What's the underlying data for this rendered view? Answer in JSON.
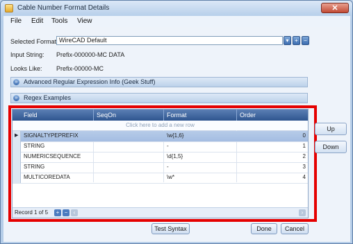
{
  "window": {
    "title": "Cable Number Format Details",
    "close_icon": "x-icon"
  },
  "menu": [
    "File",
    "Edit",
    "Tools",
    "View"
  ],
  "form": {
    "selected_format_label": "Selected Format:",
    "selected_format_value": "WireCAD Default",
    "input_string_label": "Input String:",
    "input_string_value": "Prefix-000000-MC DATA",
    "looks_like_label": "Looks Like:",
    "looks_like_value": "Prefix-00000-MC"
  },
  "panels": {
    "advanced": "Advanced Regular Expression Info (Geek Stuff)",
    "regex": "Regex Examples"
  },
  "grid": {
    "columns": [
      "Field",
      "SeqOn",
      "Format",
      "Order"
    ],
    "new_row_text": "Click here to add a new row",
    "rows": [
      {
        "field": "SIGNALTYPEPREFIX",
        "seqon": "",
        "format": "\\w{1,6}",
        "order": "0",
        "selected": true
      },
      {
        "field": "STRING",
        "seqon": "",
        "format": "-",
        "order": "1"
      },
      {
        "field": "NUMERICSEQUENCE",
        "seqon": "",
        "format": "\\d{1,5}",
        "order": "2"
      },
      {
        "field": "STRING",
        "seqon": "",
        "format": "-",
        "order": "3"
      },
      {
        "field": "MULTICOREDATA",
        "seqon": "",
        "format": "\\w*",
        "order": "4"
      }
    ],
    "record_text": "Record 1 of 5"
  },
  "side_buttons": {
    "up": "Up",
    "down": "Down"
  },
  "bottom_buttons": {
    "test": "Test Syntax",
    "done": "Done",
    "cancel": "Cancel"
  },
  "colors": {
    "highlight": "#e50000",
    "header": "#2e558f",
    "selected_row": "#b6cbe8"
  }
}
